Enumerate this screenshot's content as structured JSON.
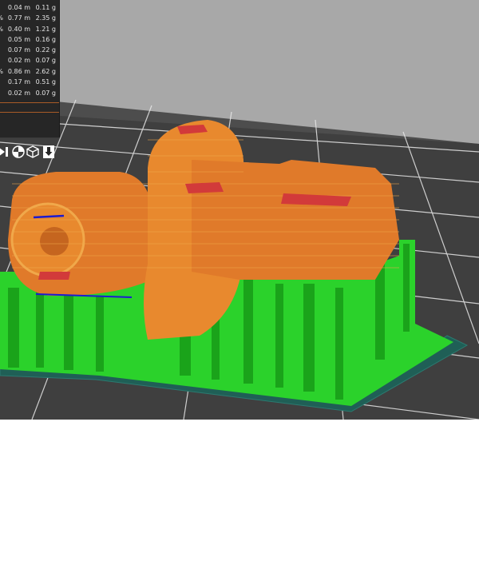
{
  "stats": {
    "rows": [
      {
        "pct": "",
        "length": "0.04 m",
        "weight": "0.11 g"
      },
      {
        "pct": "%",
        "length": "0.77 m",
        "weight": "2.35 g"
      },
      {
        "pct": "%",
        "length": "0.40 m",
        "weight": "1.21 g"
      },
      {
        "pct": "",
        "length": "0.05 m",
        "weight": "0.16 g"
      },
      {
        "pct": "",
        "length": "0.07 m",
        "weight": "0.22 g"
      },
      {
        "pct": "",
        "length": "0.02 m",
        "weight": "0.07 g"
      },
      {
        "pct": "%",
        "length": "0.86 m",
        "weight": "2.62 g"
      },
      {
        "pct": "",
        "length": "0.17 m",
        "weight": "0.51 g"
      },
      {
        "pct": "",
        "length": "0.02 m",
        "weight": "0.07 g"
      }
    ]
  },
  "toolbar": {
    "buttons": [
      {
        "name": "view-left-button",
        "icon": "left-view-icon"
      },
      {
        "name": "view-iso-button",
        "icon": "iso-view-icon"
      },
      {
        "name": "view-cube-button",
        "icon": "cube-view-icon"
      },
      {
        "name": "view-front-button",
        "icon": "download-arrow-icon"
      }
    ]
  },
  "colors": {
    "viewport_bg": "#4d4d4d",
    "viewport_sky": "#a8a8a8",
    "grid_line": "#e8e8e8",
    "build_plate": "#3a3a3a",
    "model_wall": "#e07a2a",
    "model_wall_light": "#f0a84a",
    "model_top_skin": "#d23a3a",
    "support": "#2bd22b",
    "support_dark": "#1aa31a",
    "skirt": "#1f5f56",
    "travel": "#1c1cd0",
    "panel_bg": "#262626"
  }
}
